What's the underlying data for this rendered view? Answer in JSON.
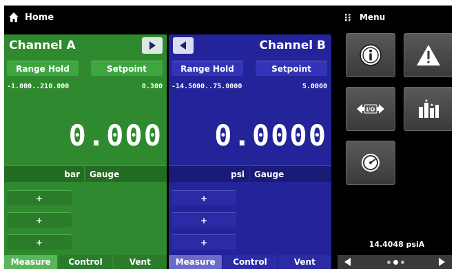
{
  "header": {
    "title": "Home",
    "icon": "home-icon"
  },
  "menu": {
    "label": "Menu",
    "icon": "grid-dots-icon"
  },
  "channel_a": {
    "title": "Channel A",
    "range_hold_label": "Range Hold",
    "setpoint_label": "Setpoint",
    "range": "-1.000..210.000",
    "setpoint_value": "0.300",
    "reading": "0.000",
    "unit": "bar",
    "mode": "Gauge",
    "plus_buttons": [
      "+",
      "+",
      "+"
    ],
    "tabs": [
      "Measure",
      "Control",
      "Vent"
    ],
    "color": "#2f8a2f"
  },
  "channel_b": {
    "title": "Channel B",
    "range_hold_label": "Range Hold",
    "setpoint_label": "Setpoint",
    "range": "-14.5000..75.0000",
    "setpoint_value": "5.0000",
    "reading": "0.0000",
    "unit": "psi",
    "mode": "Gauge",
    "plus_buttons": [
      "+",
      "+",
      "+"
    ],
    "tabs": [
      "Measure",
      "Control",
      "Vent"
    ],
    "color": "#23239a"
  },
  "tiles": [
    "info-icon",
    "alarm-warning-icon",
    "io-transfer-icon",
    "applications-icon",
    "gauge-dial-icon"
  ],
  "barometer": {
    "value": "14.4048 psiA"
  }
}
